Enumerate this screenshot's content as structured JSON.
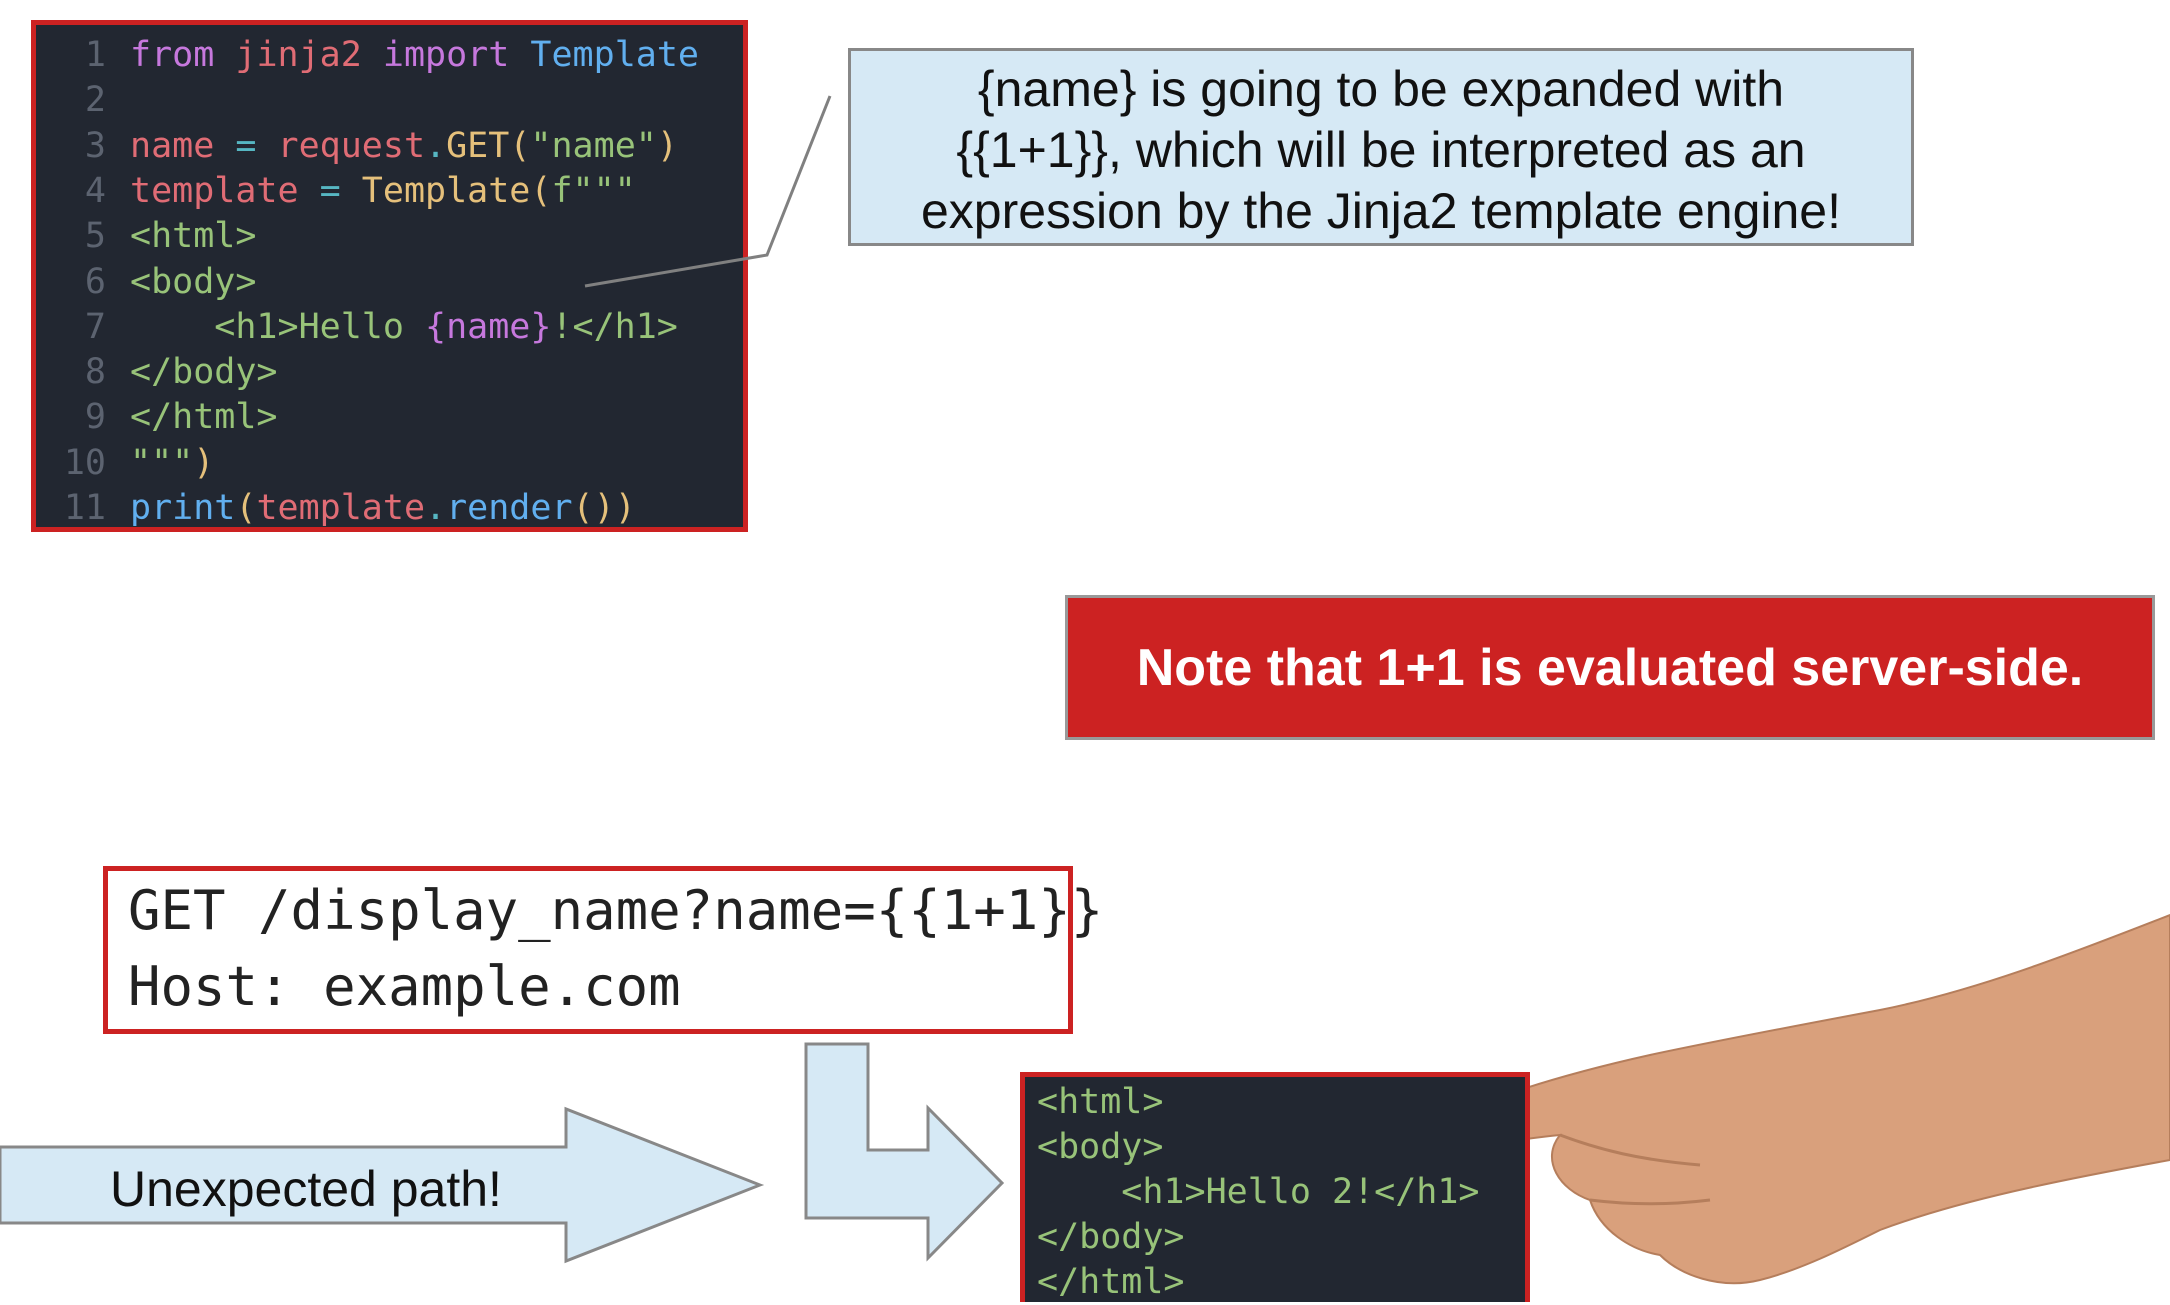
{
  "code": {
    "lines": [
      {
        "n": "1",
        "parts": [
          [
            "from",
            "k-kw"
          ],
          [
            " ",
            ""
          ],
          [
            "jinja2",
            "k-red"
          ],
          [
            " ",
            ""
          ],
          [
            "import",
            "k-kw"
          ],
          [
            " ",
            ""
          ],
          [
            "Template",
            "k-blue"
          ]
        ]
      },
      {
        "n": "2",
        "parts": []
      },
      {
        "n": "3",
        "parts": [
          [
            "name",
            "k-red"
          ],
          [
            " = ",
            "k-cyan"
          ],
          [
            "request",
            "k-red"
          ],
          [
            ".",
            "k-cyan"
          ],
          [
            "GET",
            "k-yellow"
          ],
          [
            "(",
            "k-paren"
          ],
          [
            "\"name\"",
            "k-green"
          ],
          [
            ")",
            "k-paren"
          ]
        ]
      },
      {
        "n": "4",
        "parts": [
          [
            "template",
            "k-red"
          ],
          [
            " = ",
            "k-cyan"
          ],
          [
            "Template",
            "k-yellow"
          ],
          [
            "(",
            "k-paren"
          ],
          [
            "f\"\"\"",
            "k-green"
          ]
        ]
      },
      {
        "n": "5",
        "parts": [
          [
            "<html>",
            "k-green"
          ]
        ]
      },
      {
        "n": "6",
        "parts": [
          [
            "<body>",
            "k-green"
          ]
        ]
      },
      {
        "n": "7",
        "parts": [
          [
            "    <h1>Hello ",
            "k-green"
          ],
          [
            "{name}",
            "k-purple"
          ],
          [
            "!</h1>",
            "k-green"
          ]
        ]
      },
      {
        "n": "8",
        "parts": [
          [
            "</body>",
            "k-green"
          ]
        ]
      },
      {
        "n": "9",
        "parts": [
          [
            "</html>",
            "k-green"
          ]
        ]
      },
      {
        "n": "10",
        "parts": [
          [
            "\"\"\"",
            "k-green"
          ],
          [
            ")",
            "k-paren"
          ]
        ]
      },
      {
        "n": "11",
        "parts": [
          [
            "print",
            "k-blue"
          ],
          [
            "(",
            "k-paren"
          ],
          [
            "template",
            "k-red"
          ],
          [
            ".",
            "k-cyan"
          ],
          [
            "render",
            "k-blue"
          ],
          [
            "()",
            "k-paren"
          ],
          [
            ")",
            "k-paren"
          ]
        ]
      }
    ]
  },
  "callout": {
    "lines": [
      "{name} is going to be expanded with",
      "{{1+1}}, which will be interpreted as an",
      "expression by the Jinja2 template engine!"
    ]
  },
  "note": {
    "text": "Note that 1+1 is evaluated server-side."
  },
  "request": {
    "line1": "GET /display_name?name={{1+1}}",
    "line2": "Host: example.com"
  },
  "output": {
    "lines": [
      "<html>",
      "<body>",
      "    <h1>Hello 2!</h1>",
      "</body>",
      "</html>"
    ]
  },
  "arrow": {
    "label": "Unexpected path!"
  },
  "colors": {
    "accent_red": "#cc2222",
    "callout_blue": "#d6e9f5",
    "code_bg": "#222731"
  }
}
